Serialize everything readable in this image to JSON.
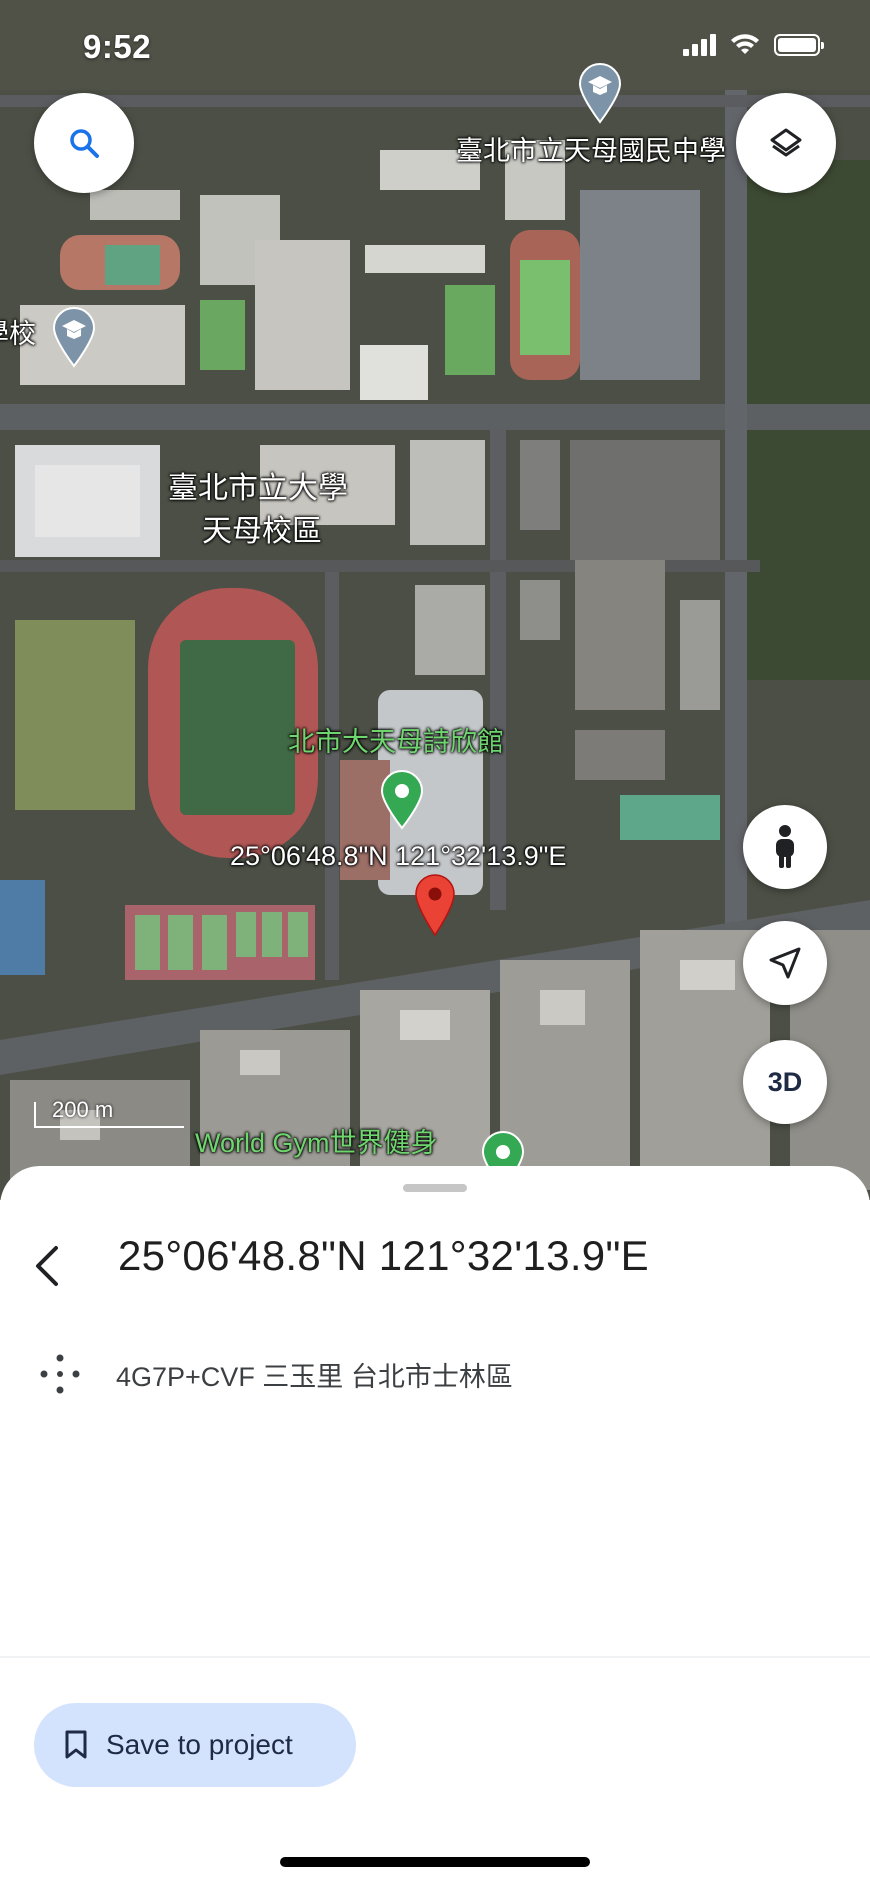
{
  "status_bar": {
    "time": "9:52"
  },
  "map": {
    "labels": {
      "school_top": "臺北市立天母國民中學",
      "school_left": "學校",
      "university_line1": "臺北市立大學",
      "university_line2": "天母校區",
      "gym_hall": "北市大天母詩欣館",
      "dropped_pin_coords": "25°06'48.8\"N 121°32'13.9\"E",
      "world_gym": "World Gym世界健身"
    },
    "scale": "200 m",
    "controls": {
      "search_icon": "search-icon",
      "layers_icon": "layers-icon",
      "street_view_icon": "pegman-icon",
      "location_icon": "navigation-arrow-icon",
      "three_d_label": "3D"
    },
    "colors": {
      "dropped_pin": "#ea4335",
      "poi_pin": "#34a853",
      "school_pin": "#7d93a8"
    }
  },
  "sheet": {
    "title": "25°06'48.8\"N 121°32'13.9\"E",
    "plus_code": "4G7P+CVF 三玉里 台北市士林區",
    "save_button_label": "Save to project",
    "colors": {
      "save_button_bg": "#d3e3fd"
    }
  }
}
